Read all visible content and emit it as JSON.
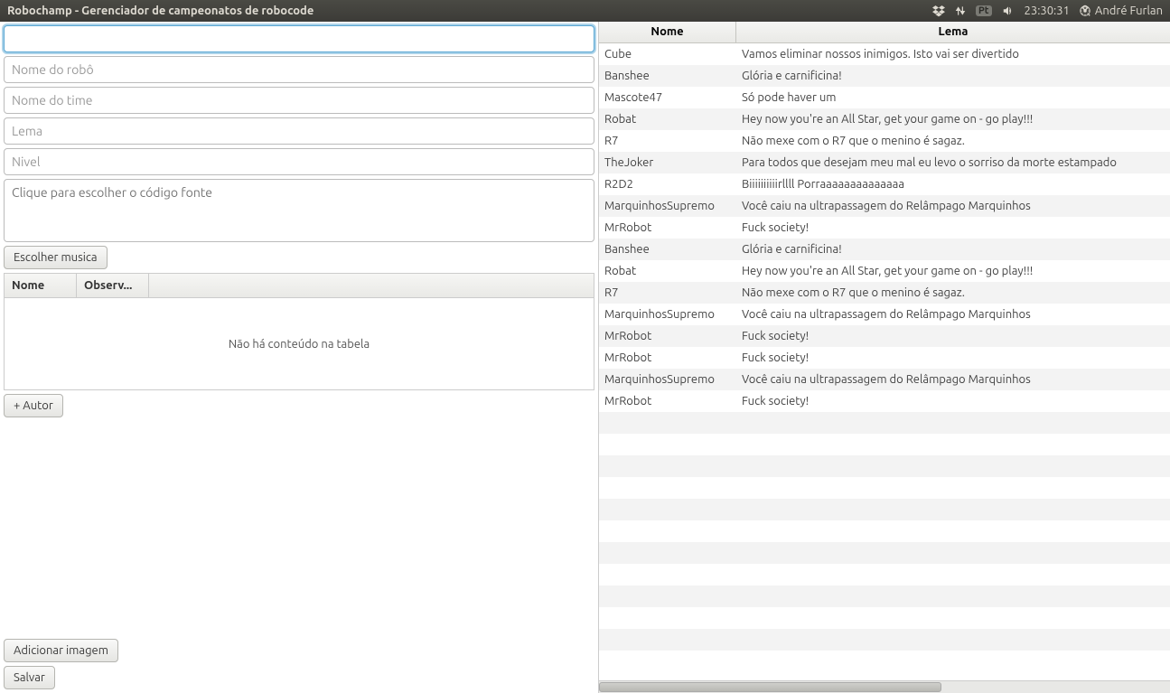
{
  "titlebar": {
    "title": "Robochamp - Gerenciador de campeonatos de robocode",
    "lang": "Pt",
    "clock": "23:30:31",
    "user": "André Furlan"
  },
  "form": {
    "field1_placeholder": "",
    "robot_name_placeholder": "Nome do robô",
    "team_name_placeholder": "Nome do time",
    "lema_placeholder": "Lema",
    "nivel_placeholder": "Nivel",
    "source_placeholder": "Clique para escolher o código fonte",
    "choose_music_label": "Escolher musica",
    "table_col_nome": "Nome",
    "table_col_observ": "Observ...",
    "table_empty": "Não há conteúdo na tabela",
    "add_author_label": "+ Autor",
    "add_image_label": "Adicionar imagem",
    "save_label": "Salvar"
  },
  "right_table": {
    "col_nome": "Nome",
    "col_lema": "Lema",
    "rows": [
      {
        "nome": "Cube",
        "lema": "Vamos eliminar nossos inimigos. Isto vai ser divertido"
      },
      {
        "nome": "Banshee",
        "lema": "Glória e carnificina!"
      },
      {
        "nome": "Mascote47",
        "lema": "Só pode haver um"
      },
      {
        "nome": "Robat",
        "lema": "Hey now you're an All Star, get your game on - go play!!!"
      },
      {
        "nome": "R7",
        "lema": "Não mexe com o R7 que o menino é sagaz."
      },
      {
        "nome": "TheJoker",
        "lema": "Para todos que desejam meu mal eu levo o sorriso da morte estampado"
      },
      {
        "nome": "R2D2",
        "lema": "Biiiiiiiiiirllll Porraaaaaaaaaaaaaa"
      },
      {
        "nome": "MarquinhosSupremo",
        "lema": "Você caiu na ultrapassagem do Relâmpago Marquinhos"
      },
      {
        "nome": "MrRobot",
        "lema": "Fuck society!"
      },
      {
        "nome": "Banshee",
        "lema": "Glória e carnificina!"
      },
      {
        "nome": "Robat",
        "lema": "Hey now you're an All Star, get your game on - go play!!!"
      },
      {
        "nome": "R7",
        "lema": "Não mexe com o R7 que o menino é sagaz."
      },
      {
        "nome": "MarquinhosSupremo",
        "lema": "Você caiu na ultrapassagem do Relâmpago Marquinhos"
      },
      {
        "nome": "MrRobot",
        "lema": "Fuck society!"
      },
      {
        "nome": "MrRobot",
        "lema": "Fuck society!"
      },
      {
        "nome": "MarquinhosSupremo",
        "lema": "Você caiu na ultrapassagem do Relâmpago Marquinhos"
      },
      {
        "nome": "MrRobot",
        "lema": "Fuck society!"
      }
    ],
    "extra_empty_rows": 12
  }
}
